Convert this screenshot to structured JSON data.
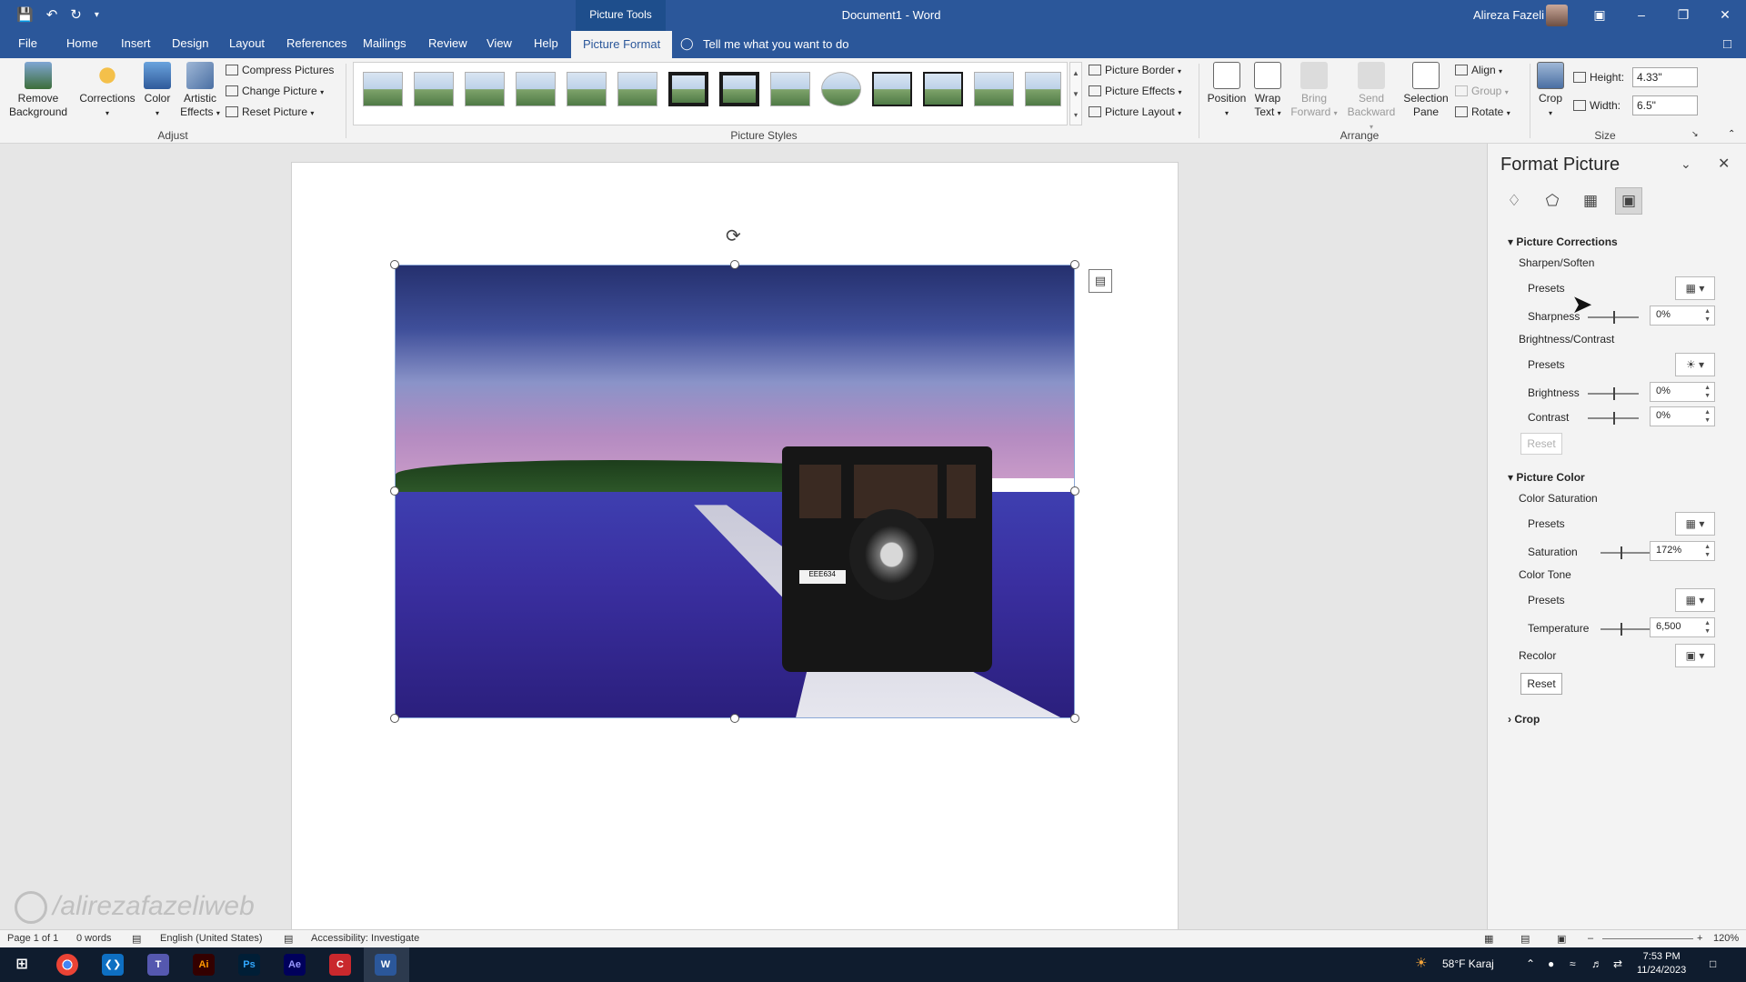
{
  "titlebar": {
    "context_tab": "Picture Tools",
    "doc_title": "Document1  -  Word",
    "user_name": "Alireza Fazeli"
  },
  "tabs": [
    "File",
    "Home",
    "Insert",
    "Design",
    "Layout",
    "References",
    "Mailings",
    "Review",
    "View",
    "Help",
    "Picture Format"
  ],
  "tell_me": "Tell me what you want to do",
  "ribbon": {
    "adjust": {
      "remove_background": [
        "Remove",
        "Background"
      ],
      "corrections": "Corrections",
      "color": "Color",
      "artistic_effects": [
        "Artistic",
        "Effects"
      ],
      "compress": "Compress Pictures",
      "change": "Change Picture",
      "reset": "Reset Picture",
      "label": "Adjust"
    },
    "styles": {
      "label": "Picture Styles",
      "border": "Picture Border",
      "effects": "Picture Effects",
      "layout": "Picture Layout"
    },
    "arrange": {
      "label": "Arrange",
      "position": "Position",
      "wrap_text": [
        "Wrap",
        "Text"
      ],
      "bring_forward": [
        "Bring",
        "Forward"
      ],
      "send_backward": [
        "Send",
        "Backward"
      ],
      "selection_pane": [
        "Selection",
        "Pane"
      ],
      "align": "Align",
      "group": "Group",
      "rotate": "Rotate"
    },
    "size": {
      "label": "Size",
      "crop": "Crop",
      "height_label": "Height:",
      "height_value": "4.33\"",
      "width_label": "Width:",
      "width_value": "6.5\""
    }
  },
  "picture": {
    "plate": "EEE634"
  },
  "watermark": "/alirezafazeliweb",
  "panel": {
    "title": "Format Picture",
    "corrections": {
      "heading": "Picture Corrections",
      "sharpen_soften": "Sharpen/Soften",
      "presets": "Presets",
      "sharpness_label": "Sharpness",
      "sharpness_value": "0%",
      "brightness_contrast": "Brightness/Contrast",
      "presets2": "Presets",
      "brightness_label": "Brightness",
      "brightness_value": "0%",
      "contrast_label": "Contrast",
      "contrast_value": "0%",
      "reset": "Reset"
    },
    "color": {
      "heading": "Picture Color",
      "saturation_heading": "Color Saturation",
      "presets": "Presets",
      "saturation_label": "Saturation",
      "saturation_value": "172%",
      "tone_heading": "Color Tone",
      "presets2": "Presets",
      "temperature_label": "Temperature",
      "temperature_value": "6,500",
      "recolor": "Recolor",
      "reset": "Reset"
    },
    "crop": "Crop"
  },
  "statusbar": {
    "page": "Page 1 of 1",
    "words": "0 words",
    "language": "English (United States)",
    "accessibility": "Accessibility: Investigate",
    "zoom": "120%"
  },
  "taskbar": {
    "weather": "58°F  Karaj",
    "time": "7:53 PM",
    "date": "11/24/2023",
    "apps": [
      "Ai",
      "Ps",
      "Ae"
    ]
  },
  "colors": {
    "accent": "#2b579a"
  }
}
